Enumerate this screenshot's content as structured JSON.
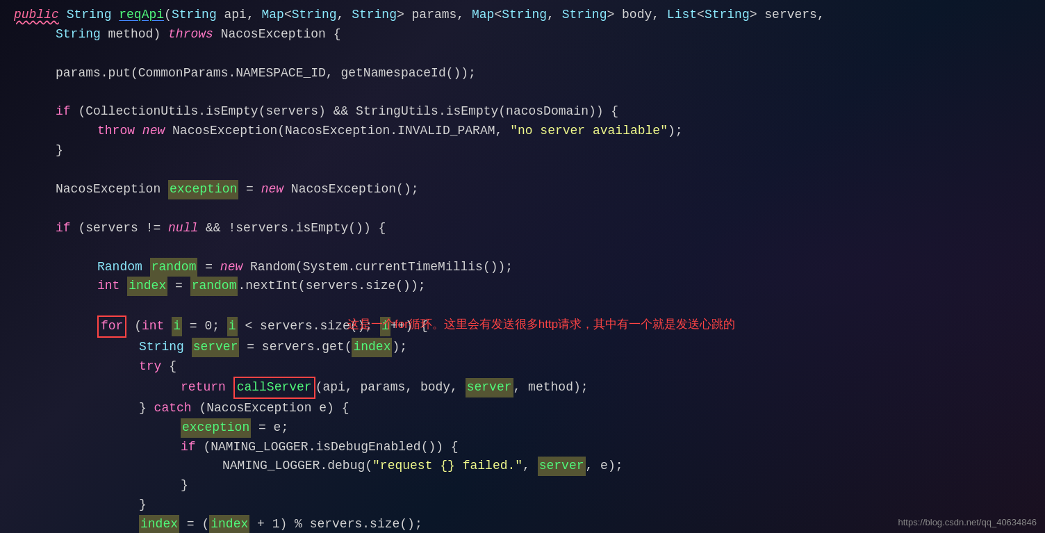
{
  "code": {
    "lines": [
      {
        "id": "line1",
        "indent": 0,
        "parts": [
          {
            "type": "kw-public",
            "text": "public"
          },
          {
            "type": "plain",
            "text": " "
          },
          {
            "type": "type",
            "text": "String"
          },
          {
            "type": "plain",
            "text": " "
          },
          {
            "type": "method-underline",
            "text": "reqApi"
          },
          {
            "type": "plain",
            "text": "("
          },
          {
            "type": "type",
            "text": "String"
          },
          {
            "type": "plain",
            "text": " api, "
          },
          {
            "type": "type",
            "text": "Map"
          },
          {
            "type": "plain",
            "text": "<"
          },
          {
            "type": "type",
            "text": "String"
          },
          {
            "type": "plain",
            "text": ", "
          },
          {
            "type": "type",
            "text": "String"
          },
          {
            "type": "plain",
            "text": "> params, "
          },
          {
            "type": "type",
            "text": "Map"
          },
          {
            "type": "plain",
            "text": "<"
          },
          {
            "type": "type",
            "text": "String"
          },
          {
            "type": "plain",
            "text": ", "
          },
          {
            "type": "type",
            "text": "String"
          },
          {
            "type": "plain",
            "text": "> body, "
          },
          {
            "type": "type",
            "text": "List"
          },
          {
            "type": "plain",
            "text": "<"
          },
          {
            "type": "type",
            "text": "String"
          },
          {
            "type": "plain",
            "text": "> servers,"
          }
        ]
      },
      {
        "id": "line2",
        "indent": 1,
        "parts": [
          {
            "type": "type",
            "text": "String"
          },
          {
            "type": "plain",
            "text": " method) "
          },
          {
            "type": "kw-italic",
            "text": "throws"
          },
          {
            "type": "plain",
            "text": " NacosException {"
          }
        ]
      },
      {
        "id": "line-blank1",
        "blank": true
      },
      {
        "id": "line3",
        "indent": 1,
        "parts": [
          {
            "type": "plain",
            "text": "params.put(CommonParams.NAMESPACE_ID, getNamespaceId());"
          }
        ]
      },
      {
        "id": "line-blank2",
        "blank": true
      },
      {
        "id": "line4",
        "indent": 1,
        "parts": [
          {
            "type": "kw",
            "text": "if"
          },
          {
            "type": "plain",
            "text": " (CollectionUtils.isEmpty(servers) && StringUtils.isEmpty(nacosDomain)) {"
          }
        ]
      },
      {
        "id": "line5",
        "indent": 2,
        "parts": [
          {
            "type": "kw-throw",
            "text": "throw"
          },
          {
            "type": "plain",
            "text": " "
          },
          {
            "type": "kw-italic",
            "text": "new"
          },
          {
            "type": "plain",
            "text": " NacosException(NacosException.INVALID_PARAM, "
          },
          {
            "type": "string",
            "text": "\"no server available\""
          },
          {
            "type": "plain",
            "text": ");"
          }
        ]
      },
      {
        "id": "line6",
        "indent": 1,
        "parts": [
          {
            "type": "plain",
            "text": "}"
          }
        ]
      },
      {
        "id": "line-blank3",
        "blank": true
      },
      {
        "id": "line7",
        "indent": 1,
        "parts": [
          {
            "type": "plain",
            "text": "NacosException "
          },
          {
            "type": "highlight-var",
            "text": "exception"
          },
          {
            "type": "plain",
            "text": " = "
          },
          {
            "type": "kw-italic",
            "text": "new"
          },
          {
            "type": "plain",
            "text": " NacosException();"
          }
        ]
      },
      {
        "id": "line-blank4",
        "blank": true
      },
      {
        "id": "line8",
        "indent": 1,
        "parts": [
          {
            "type": "kw",
            "text": "if"
          },
          {
            "type": "plain",
            "text": " (servers != "
          },
          {
            "type": "null-kw",
            "text": "null"
          },
          {
            "type": "plain",
            "text": " && !servers.isEmpty()) {"
          }
        ]
      },
      {
        "id": "line-blank5",
        "blank": true
      },
      {
        "id": "line9",
        "indent": 2,
        "parts": [
          {
            "type": "type",
            "text": "Random"
          },
          {
            "type": "plain",
            "text": " "
          },
          {
            "type": "highlight-var",
            "text": "random"
          },
          {
            "type": "plain",
            "text": " = "
          },
          {
            "type": "kw-italic",
            "text": "new"
          },
          {
            "type": "plain",
            "text": " Random(System.currentTimeMillis());"
          }
        ]
      },
      {
        "id": "line10",
        "indent": 2,
        "parts": [
          {
            "type": "kw",
            "text": "int"
          },
          {
            "type": "plain",
            "text": " "
          },
          {
            "type": "highlight-var",
            "text": "index"
          },
          {
            "type": "plain",
            "text": " = "
          },
          {
            "type": "highlight-var",
            "text": "random"
          },
          {
            "type": "plain",
            "text": ".nextInt(servers.size());"
          }
        ]
      },
      {
        "id": "line-blank6",
        "blank": true
      },
      {
        "id": "line11",
        "indent": 2,
        "parts": [
          {
            "type": "for-box",
            "text": "for"
          },
          {
            "type": "plain",
            "text": " ("
          },
          {
            "type": "kw",
            "text": "int"
          },
          {
            "type": "plain",
            "text": " "
          },
          {
            "type": "highlight-var",
            "text": "i"
          },
          {
            "type": "plain",
            "text": " = 0; "
          },
          {
            "type": "highlight-var",
            "text": "i"
          },
          {
            "type": "plain",
            "text": " < servers.size(); "
          },
          {
            "type": "highlight-var",
            "text": "i"
          },
          {
            "type": "plain",
            "text": "++) {"
          }
        ]
      },
      {
        "id": "line12",
        "indent": 3,
        "parts": [
          {
            "type": "type",
            "text": "String"
          },
          {
            "type": "plain",
            "text": " "
          },
          {
            "type": "highlight-var",
            "text": "server"
          },
          {
            "type": "plain",
            "text": " = servers.get("
          },
          {
            "type": "highlight-var",
            "text": "index"
          },
          {
            "type": "plain",
            "text": ");"
          }
        ]
      },
      {
        "id": "line13",
        "indent": 3,
        "parts": [
          {
            "type": "kw",
            "text": "try"
          },
          {
            "type": "plain",
            "text": " {"
          }
        ]
      },
      {
        "id": "line14",
        "indent": 4,
        "parts": [
          {
            "type": "kw",
            "text": "return"
          },
          {
            "type": "plain",
            "text": " "
          },
          {
            "type": "callserver-box",
            "text": "callServer"
          },
          {
            "type": "plain",
            "text": "(api, params, body, "
          },
          {
            "type": "highlight-var",
            "text": "server"
          },
          {
            "type": "plain",
            "text": ", method);"
          }
        ]
      },
      {
        "id": "line15",
        "indent": 3,
        "parts": [
          {
            "type": "plain",
            "text": "} "
          },
          {
            "type": "kw",
            "text": "catch"
          },
          {
            "type": "plain",
            "text": " (NacosException e) {"
          }
        ]
      },
      {
        "id": "line16",
        "indent": 4,
        "parts": [
          {
            "type": "highlight-var",
            "text": "exception"
          },
          {
            "type": "plain",
            "text": " = e;"
          }
        ]
      },
      {
        "id": "line17",
        "indent": 4,
        "parts": [
          {
            "type": "kw",
            "text": "if"
          },
          {
            "type": "plain",
            "text": " (NAMING_LOGGER.isDebugEnabled()) {"
          }
        ]
      },
      {
        "id": "line18",
        "indent": 5,
        "parts": [
          {
            "type": "plain",
            "text": "NAMING_LOGGER.debug("
          },
          {
            "type": "string",
            "text": "\"request {} failed.\""
          },
          {
            "type": "plain",
            "text": ", "
          },
          {
            "type": "highlight-var",
            "text": "server"
          },
          {
            "type": "plain",
            "text": ", e);"
          }
        ]
      },
      {
        "id": "line19",
        "indent": 4,
        "parts": [
          {
            "type": "plain",
            "text": "}"
          }
        ]
      },
      {
        "id": "line20",
        "indent": 3,
        "parts": [
          {
            "type": "plain",
            "text": "}"
          }
        ]
      },
      {
        "id": "line21",
        "indent": 3,
        "parts": [
          {
            "type": "highlight-var",
            "text": "index"
          },
          {
            "type": "plain",
            "text": " = ("
          },
          {
            "type": "highlight-var",
            "text": "index"
          },
          {
            "type": "plain",
            "text": " + 1) % servers.size();"
          }
        ]
      }
    ],
    "annotation": {
      "text": "这是一个for循环。这里会有发送很多http请求，其中有一个就是发送心跳的",
      "color": "#ff4444"
    },
    "watermark": "https://blog.csdn.net/qq_40634846"
  }
}
